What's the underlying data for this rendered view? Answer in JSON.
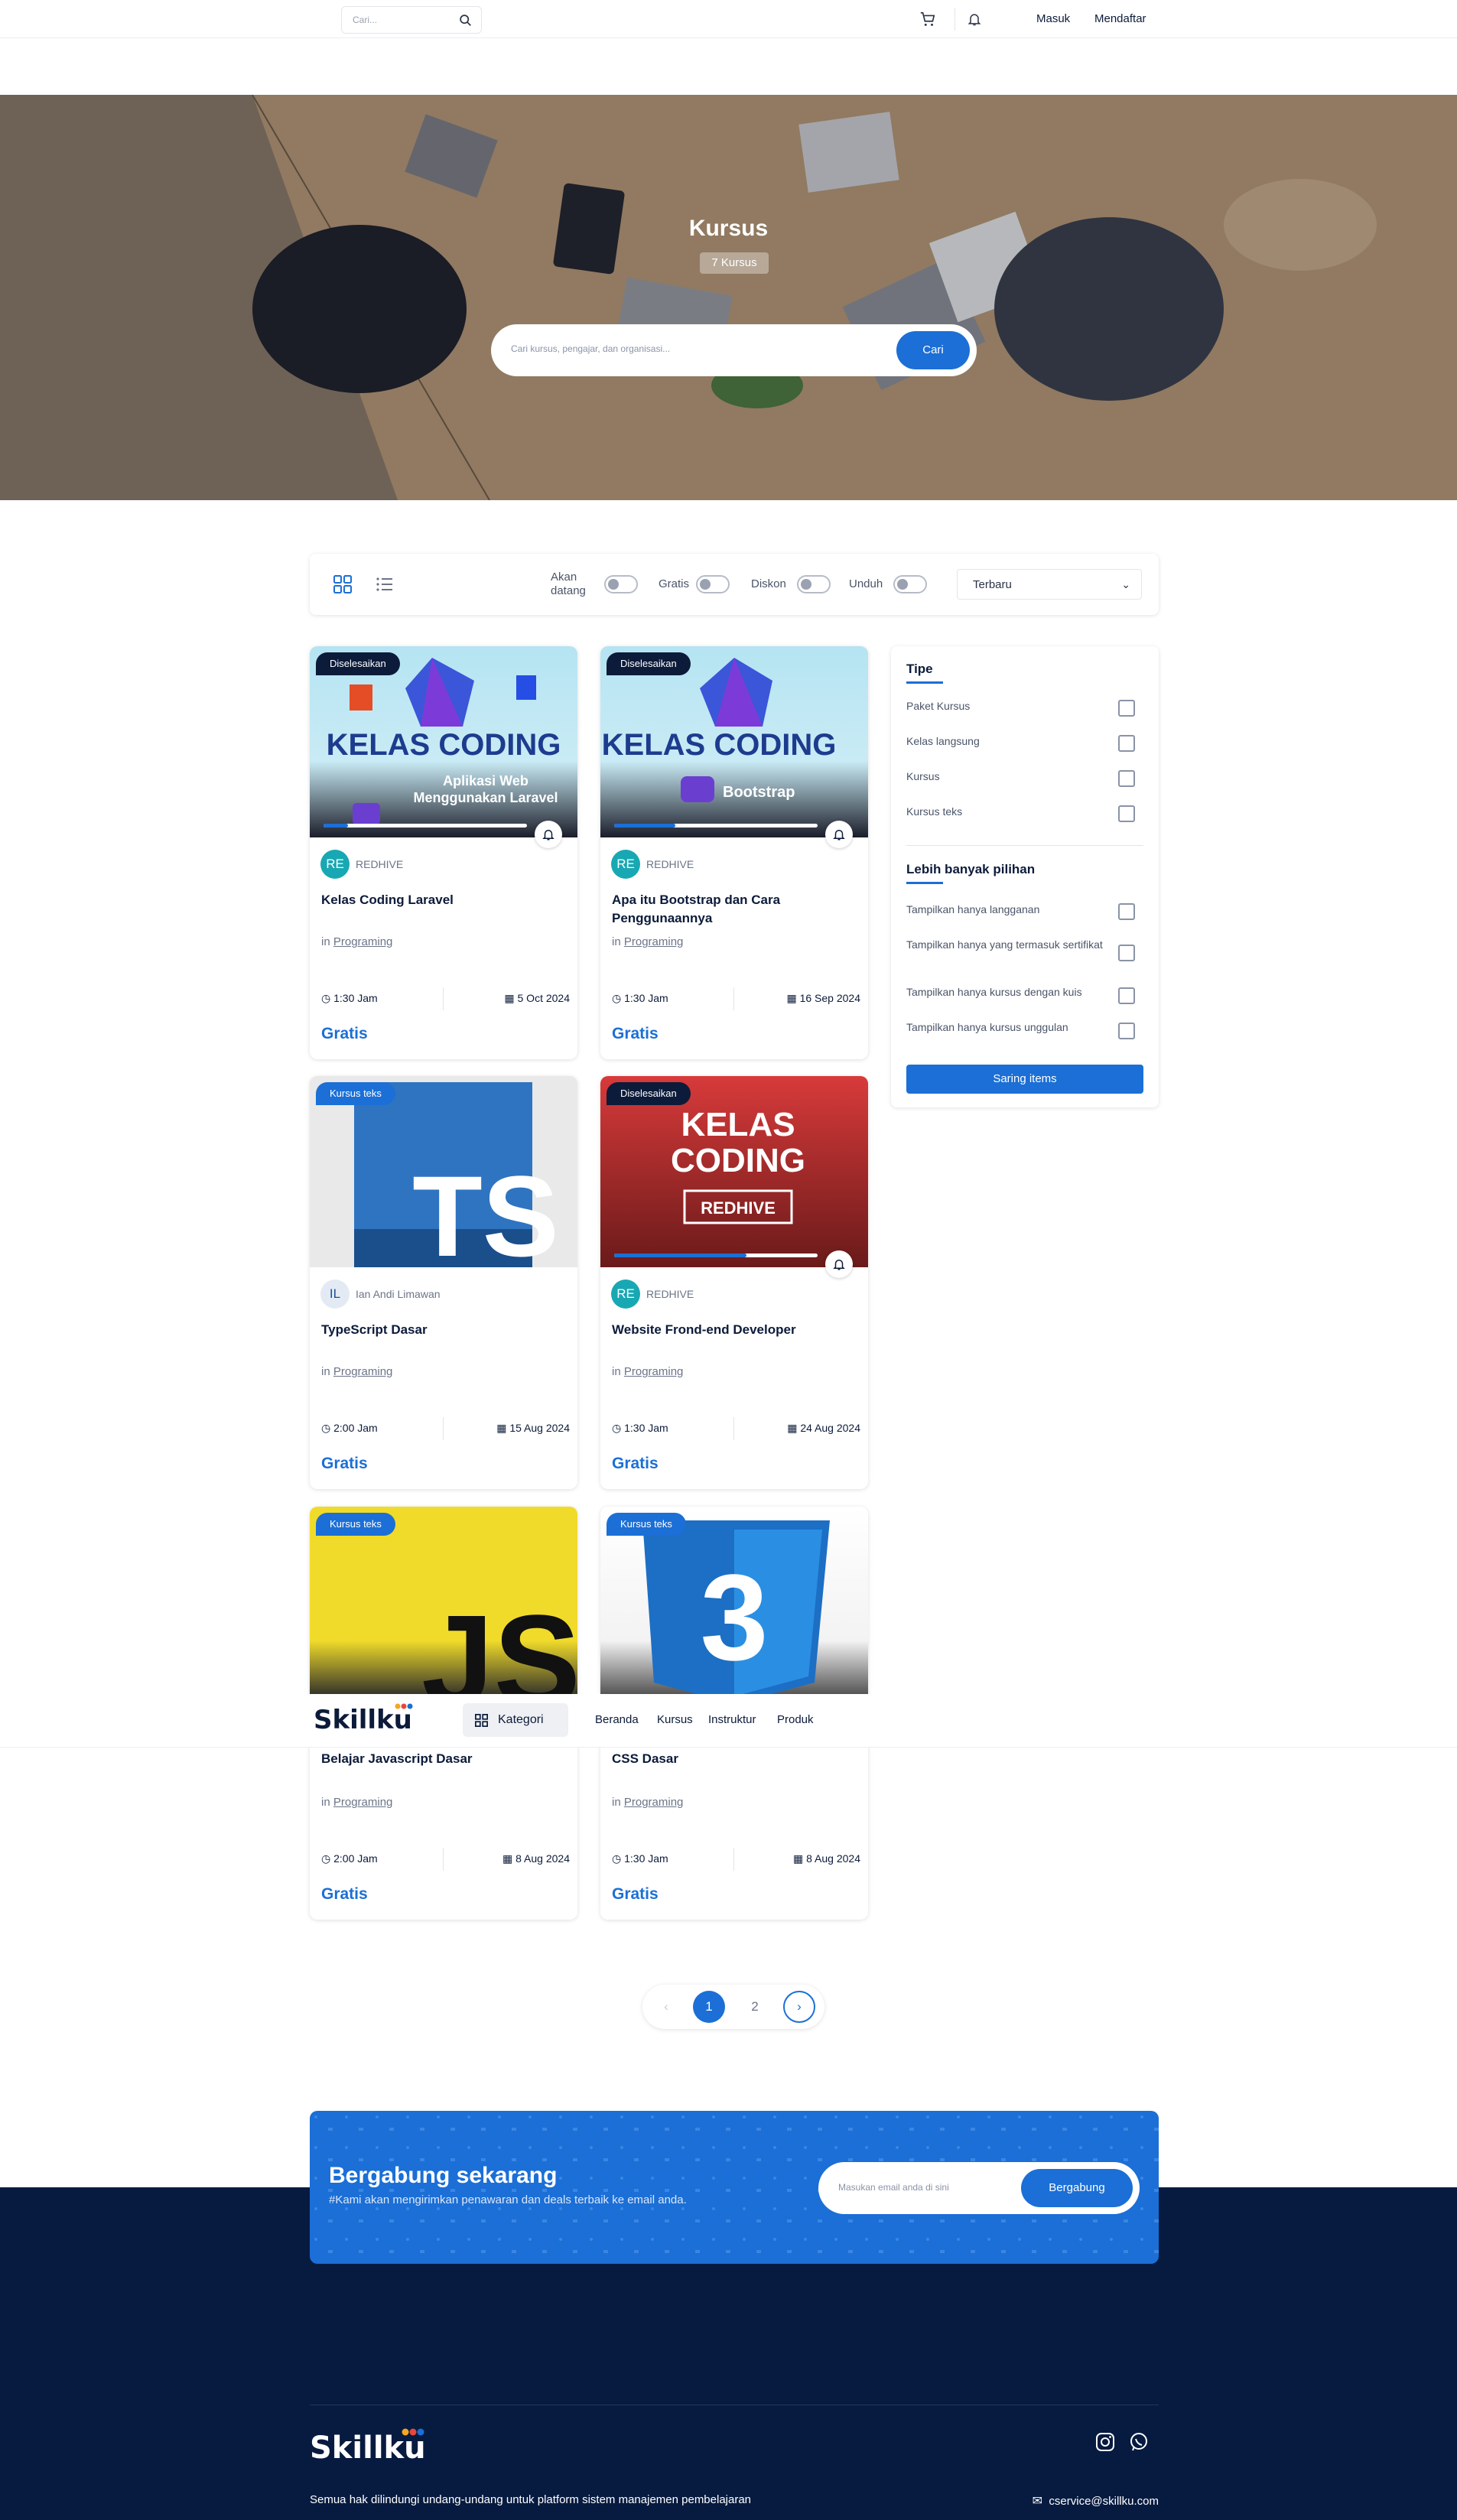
{
  "topbar": {
    "search_placeholder": "Cari...",
    "login": "Masuk",
    "register": "Mendaftar"
  },
  "hero": {
    "title": "Kursus",
    "count": "7 Kursus",
    "search_placeholder": "Cari kursus, pengajar, dan organisasi...",
    "search_button": "Cari"
  },
  "filters": {
    "upcoming": "Akan datang",
    "free": "Gratis",
    "discount": "Diskon",
    "download": "Unduh",
    "sort": "Terbaru"
  },
  "courses": [
    {
      "badge": "Diselesaikan",
      "avatar": "RE",
      "instructor": "REDHIVE",
      "title": "Kelas Coding Laravel",
      "category_prefix": "in",
      "category": "Programing",
      "duration": "1:30 Jam",
      "date": "5 Oct 2024",
      "price": "Gratis",
      "thumb_title": "KELAS CODING",
      "thumb_sub": "Aplikasi Web Menggunakan Laravel",
      "progress": 0.12
    },
    {
      "badge": "Diselesaikan",
      "avatar": "RE",
      "instructor": "REDHIVE",
      "title": "Apa itu Bootstrap dan Cara Penggunaannya",
      "category_prefix": "in",
      "category": "Programing",
      "duration": "1:30 Jam",
      "date": "16 Sep 2024",
      "price": "Gratis",
      "thumb_title": "KELAS CODING",
      "thumb_sub": "Bootstrap",
      "progress": 0.3
    },
    {
      "badge": "Kursus teks",
      "avatar": "IL",
      "instructor": "Ian Andi Limawan",
      "title": "TypeScript Dasar",
      "category_prefix": "in",
      "category": "Programing",
      "duration": "2:00 Jam",
      "date": "15 Aug 2024",
      "price": "Gratis",
      "thumb_title": "TS"
    },
    {
      "badge": "Diselesaikan",
      "avatar": "RE",
      "instructor": "REDHIVE",
      "title": "Website Frond-end Developer",
      "category_prefix": "in",
      "category": "Programing",
      "duration": "1:30 Jam",
      "date": "24 Aug 2024",
      "price": "Gratis",
      "thumb_title": "KELAS CODING",
      "thumb_sub": "REDHIVE",
      "progress": 0.65
    },
    {
      "badge": "Kursus teks",
      "title": "Belajar Javascript Dasar",
      "category_prefix": "in",
      "category": "Programing",
      "duration": "2:00 Jam",
      "date": "8 Aug 2024",
      "price": "Gratis",
      "thumb_title": "JS"
    },
    {
      "badge": "Kursus teks",
      "title": "CSS Dasar",
      "category_prefix": "in",
      "category": "Programing",
      "duration": "1:30 Jam",
      "date": "8 Aug 2024",
      "price": "Gratis",
      "thumb_title": "3"
    }
  ],
  "sidebar": {
    "type_title": "Tipe",
    "types": [
      "Paket Kursus",
      "Kelas langsung",
      "Kursus",
      "Kursus teks"
    ],
    "more_title": "Lebih banyak pilihan",
    "more": [
      "Tampilkan hanya langganan",
      "Tampilkan hanya yang termasuk sertifikat",
      "Tampilkan hanya kursus dengan kuis",
      "Tampilkan hanya kursus unggulan"
    ],
    "button": "Saring items"
  },
  "navbar": {
    "logo": "Skillku",
    "category": "Kategori",
    "links": [
      "Beranda",
      "Kursus",
      "Instruktur",
      "Produk"
    ]
  },
  "pagination": {
    "pages": [
      "1",
      "2"
    ],
    "current": "1"
  },
  "join": {
    "title": "Bergabung sekarang",
    "subtitle": "#Kami akan mengirimkan penawaran dan deals terbaik ke email anda.",
    "placeholder": "Masukan email anda di sini",
    "button": "Bergabung"
  },
  "footer": {
    "logo": "Skillku",
    "copyright": "Semua hak dilindungi undang-undang untuk platform sistem manajemen pembelajaran",
    "email": "cservice@skillku.com"
  },
  "colors": {
    "primary": "#1b6fd6",
    "navy": "#071b40",
    "dark": "#0c1b3a"
  }
}
